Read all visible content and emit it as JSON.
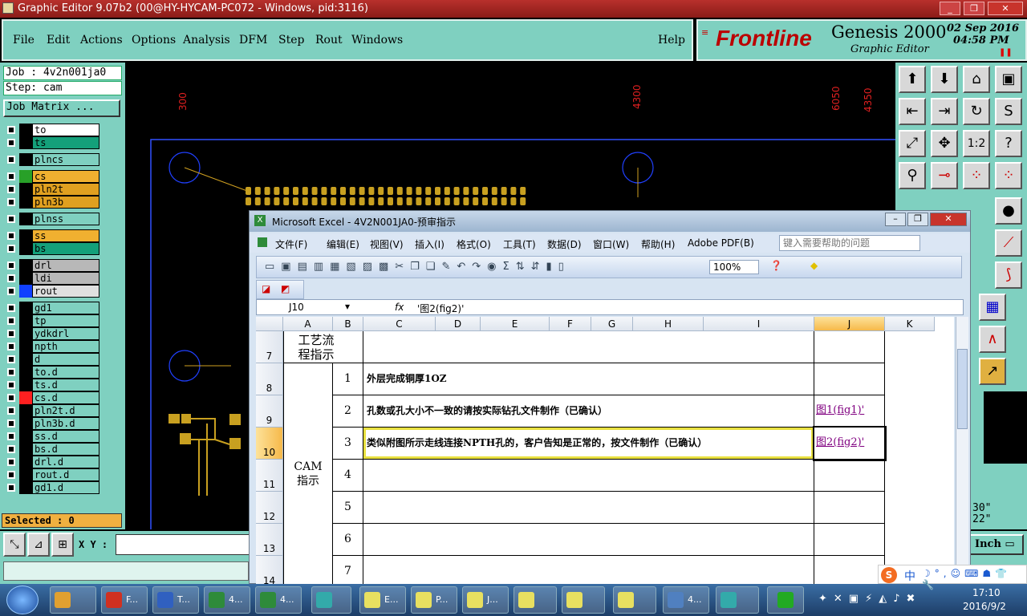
{
  "app_title": "Graphic Editor 9.07b2 (00@HY-HYCAM-PC072 - Windows, pid:3116)",
  "menu": [
    "File",
    "Edit",
    "Actions",
    "Options",
    "Analysis",
    "DFM",
    "Step",
    "Rout",
    "Windows"
  ],
  "help": "Help",
  "brand": {
    "logo": "Frontline",
    "product": "Genesis 2000",
    "subtitle": "Graphic Editor",
    "date": "02 Sep 2016",
    "time": "04:58 PM"
  },
  "job": "Job : 4v2n001ja0",
  "step": "Step: cam",
  "job_matrix": "Job Matrix ...",
  "layers": [
    {
      "name": "to",
      "color": "#ffffff",
      "swatch": "#000000"
    },
    {
      "name": "ts",
      "color": "#14a07a",
      "swatch": "#000000"
    },
    {
      "name": "plncs",
      "color": "#7fd0c0",
      "swatch": "#000000"
    },
    {
      "name": "cs",
      "color": "#f0b030",
      "swatch": "#28a028"
    },
    {
      "name": "pln2t",
      "color": "#e0a020",
      "swatch": "#000000"
    },
    {
      "name": "pln3b",
      "color": "#e0a020",
      "swatch": "#000000"
    },
    {
      "name": "plnss",
      "color": "#7fd0c0",
      "swatch": "#000000"
    },
    {
      "name": "ss",
      "color": "#f0b030",
      "swatch": "#000000"
    },
    {
      "name": "bs",
      "color": "#14a07a",
      "swatch": "#000000"
    },
    {
      "name": "drl",
      "color": "#b8b8b8",
      "swatch": "#000000"
    },
    {
      "name": "ldi",
      "color": "#b8b8b8",
      "swatch": "#000000"
    },
    {
      "name": "rout",
      "color": "#e0e0e0",
      "swatch": "#1040ff"
    },
    {
      "name": "gd1",
      "color": "#7fd0c0",
      "swatch": "#000000"
    },
    {
      "name": "tp",
      "color": "#7fd0c0",
      "swatch": "#000000"
    },
    {
      "name": "ydkdrl",
      "color": "#7fd0c0",
      "swatch": "#000000"
    },
    {
      "name": "npth",
      "color": "#7fd0c0",
      "swatch": "#000000"
    },
    {
      "name": "d",
      "color": "#7fd0c0",
      "swatch": "#000000"
    },
    {
      "name": "to.d",
      "color": "#7fd0c0",
      "swatch": "#000000"
    },
    {
      "name": "ts.d",
      "color": "#7fd0c0",
      "swatch": "#000000"
    },
    {
      "name": "cs.d",
      "color": "#7fd0c0",
      "swatch": "#ff2020"
    },
    {
      "name": "pln2t.d",
      "color": "#7fd0c0",
      "swatch": "#000000"
    },
    {
      "name": "pln3b.d",
      "color": "#7fd0c0",
      "swatch": "#000000"
    },
    {
      "name": "ss.d",
      "color": "#7fd0c0",
      "swatch": "#000000"
    },
    {
      "name": "bs.d",
      "color": "#7fd0c0",
      "swatch": "#000000"
    },
    {
      "name": "drl.d",
      "color": "#7fd0c0",
      "swatch": "#000000"
    },
    {
      "name": "rout.d",
      "color": "#7fd0c0",
      "swatch": "#000000"
    },
    {
      "name": "gd1.d",
      "color": "#7fd0c0",
      "swatch": "#000000"
    }
  ],
  "selected": "Selected : 0",
  "xy_label": "X Y :",
  "units": "Inch",
  "readout": [
    "30\"",
    "22\""
  ],
  "ruler": [
    "300",
    "4300",
    "6050",
    "4350"
  ],
  "excel": {
    "title": "Microsoft Excel - 4V2N001JA0-预审指示",
    "menu": [
      "文件(F)",
      "编辑(E)",
      "视图(V)",
      "插入(I)",
      "格式(O)",
      "工具(T)",
      "数据(D)",
      "窗口(W)",
      "帮助(H)",
      "Adobe PDF(B)"
    ],
    "help_placeholder": "键入需要帮助的问题",
    "zoom": "100%",
    "cell_ref": "J10",
    "fx": "fx",
    "formula": "'图2(fig2)'",
    "columns": [
      "A",
      "B",
      "C",
      "D",
      "E",
      "F",
      "G",
      "H",
      "I",
      "J",
      "K"
    ],
    "rows": [
      "7",
      "8",
      "9",
      "10",
      "11",
      "12",
      "13",
      "14"
    ],
    "header_row": "工艺流程指示",
    "section": "CAM指示",
    "items": [
      {
        "num": "1",
        "text": "外层完成铜厚1OZ",
        "ref": ""
      },
      {
        "num": "2",
        "text": "孔数或孔大小不一致的请按实际钻孔文件制作（已确认）",
        "ref": "图1(fig1)'"
      },
      {
        "num": "3",
        "text": "类似附图所示走线连接NPTH孔的，客户告知是正常的，按文件制作（已确认）",
        "ref": "图2(fig2)'"
      },
      {
        "num": "4",
        "text": "",
        "ref": ""
      },
      {
        "num": "5",
        "text": "",
        "ref": ""
      },
      {
        "num": "6",
        "text": "",
        "ref": ""
      },
      {
        "num": "7",
        "text": "",
        "ref": ""
      }
    ]
  },
  "taskbar": {
    "items": [
      "F...",
      "T...",
      "4...",
      "4...",
      "E...",
      "P...",
      "J...",
      "4..."
    ],
    "time": "17:10",
    "date": "2016/9/2",
    "ime": "中"
  }
}
